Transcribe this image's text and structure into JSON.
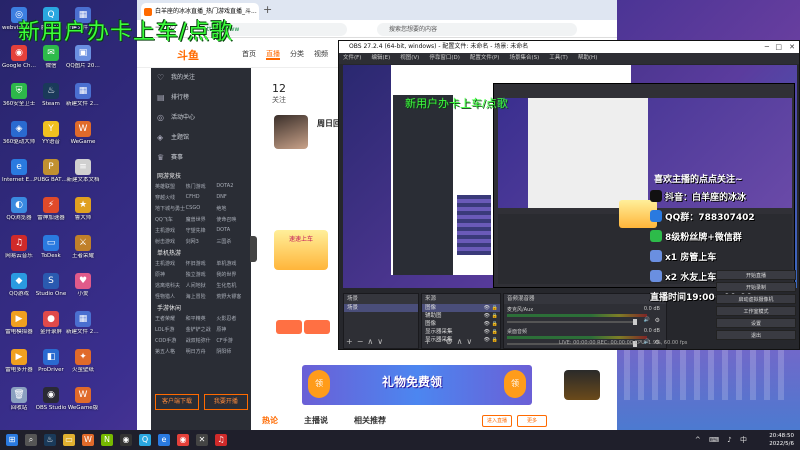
{
  "overlay_title": "新用户办卡上车/点歌",
  "desktop_icons": [
    {
      "label": "webviewget...",
      "color": "#3c7ee0",
      "glyph": "◎"
    },
    {
      "label": "腾讯QQ",
      "color": "#2aa7e0",
      "glyph": "Q"
    },
    {
      "label": "新建文件 20211...",
      "color": "#4a6fd0",
      "glyph": "▦"
    },
    {
      "label": "Google Chrome",
      "color": "#e4403a",
      "glyph": "◉"
    },
    {
      "label": "微信",
      "color": "#2dbb4a",
      "glyph": "✉"
    },
    {
      "label": "QQ图片 2021121...",
      "color": "#6a8fe0",
      "glyph": "▣"
    },
    {
      "label": "360安全卫士",
      "color": "#2db84a",
      "glyph": "⛨"
    },
    {
      "label": "Steam",
      "color": "#1a3a5a",
      "glyph": "♨"
    },
    {
      "label": "新建文件 2021121...",
      "color": "#4a6fd0",
      "glyph": "▦"
    },
    {
      "label": "360驱动大师",
      "color": "#2a6ad0",
      "glyph": "◈"
    },
    {
      "label": "YY语音",
      "color": "#f0c020",
      "glyph": "Y"
    },
    {
      "label": "WeGame",
      "color": "#e06a2a",
      "glyph": "W"
    },
    {
      "label": "Internet Explorer",
      "color": "#2a7ae0",
      "glyph": "e"
    },
    {
      "label": "PUBG BATTLEGR...",
      "color": "#c09030",
      "glyph": "P"
    },
    {
      "label": "新建文本文档",
      "color": "#d0d0d0",
      "glyph": "≡"
    },
    {
      "label": "QQ浏览器",
      "color": "#3a8ae0",
      "glyph": "◐"
    },
    {
      "label": "雷神加速器",
      "color": "#e04a2a",
      "glyph": "⚡"
    },
    {
      "label": "鲁大师",
      "color": "#e0a020",
      "glyph": "★"
    },
    {
      "label": "网易云音乐",
      "color": "#d02a2a",
      "glyph": "♫"
    },
    {
      "label": "ToDesk",
      "color": "#2a7ae0",
      "glyph": "▭"
    },
    {
      "label": "王者荣耀",
      "color": "#c0802a",
      "glyph": "⚔"
    },
    {
      "label": "QQ游戏",
      "color": "#2a9ae0",
      "glyph": "◆"
    },
    {
      "label": "Studio One",
      "color": "#2a5ab0",
      "glyph": "S"
    },
    {
      "label": "小爱",
      "color": "#e05a8a",
      "glyph": "♥"
    },
    {
      "label": "雷电模拟器",
      "color": "#f0a020",
      "glyph": "▶"
    },
    {
      "label": "金舟录屏",
      "color": "#e04a4a",
      "glyph": "●"
    },
    {
      "label": "新建文件 2022030...",
      "color": "#4a6fd0",
      "glyph": "▦"
    },
    {
      "label": "雷电多开器",
      "color": "#f0a020",
      "glyph": "▶"
    },
    {
      "label": "ProDriver",
      "color": "#2a6ad0",
      "glyph": "◧"
    },
    {
      "label": "火萤壁纸",
      "color": "#e06a2a",
      "glyph": "✦"
    },
    {
      "label": "回收站",
      "color": "#8aa0c0",
      "glyph": "🗑"
    },
    {
      "label": "OBS Studio",
      "color": "#2a2a35",
      "glyph": "◉"
    },
    {
      "label": "WeGame版",
      "color": "#e06a2a",
      "glyph": "W"
    }
  ],
  "browser": {
    "tab_title": "白羊座的冰冰直播_热门游戏直播_斗...",
    "new_tab": "+",
    "url": "https://www.douyu.com/...",
    "url_domain": "https://www",
    "search_placeholder": "搜索您想要的内容",
    "logo": "斗鱼",
    "nav": [
      "首页",
      "直播",
      "分类",
      "视频",
      "游戏"
    ],
    "sidebar_items": [
      "我的关注",
      "排行榜",
      "活动中心",
      "主题馆",
      "赛事"
    ],
    "sidebar_cat_online": "网游竞技",
    "games_online": [
      "英雄联盟",
      "热门游戏",
      "DOTA2",
      "穿越火线",
      "CFHD",
      "DNF",
      "地下城与勇士",
      "CSGO",
      "绝地",
      "QQ飞车",
      "魔兽世界",
      "使命召唤",
      "主机游戏",
      "守望先锋",
      "DOTA",
      "射击游戏",
      "剑网3",
      "三国杀"
    ],
    "sidebar_cat_single": "单机热游",
    "games_single": [
      "主机游戏",
      "怀旧游戏",
      "单机游戏",
      "原神",
      "独立游戏",
      "我的世界",
      "逃离塔科夫",
      "人间地狱",
      "生化危机",
      "怪物猎人",
      "海上冒险",
      "荒野大镖客"
    ],
    "sidebar_cat_mobile": "手游休闲",
    "games_mobile": [
      "王者荣耀",
      "和平精英",
      "火影忍者",
      "LOL手游",
      "金铲铲之战",
      "原神",
      "COD手游",
      "战双帕弥什",
      "CF手游",
      "第五人格",
      "明日方舟",
      "阴阳师"
    ],
    "btn_upload": "客户端下载",
    "btn_app": "我要开播",
    "streamer_count": "12",
    "streamer_count_label": "关注",
    "streamer_label2": "直播间",
    "pname": "周日回",
    "promo_text": "速速上车",
    "gift_text": "礼物免费领",
    "gift_badge": "领",
    "hot_tabs": [
      "热论",
      "主播说",
      "相关推荐"
    ],
    "small_btn": "进入直播",
    "small_btn2": "更多"
  },
  "obs": {
    "title": "OBS 27.2.4 (64-bit, windows) - 配置文件: 未命名 - 场景: 未命名",
    "menu": [
      "文件(F)",
      "编辑(E)",
      "视图(V)",
      "停靠窗口(D)",
      "配置文件(P)",
      "场景集合(S)",
      "工具(T)",
      "帮助(H)"
    ],
    "scenes_header": "场景",
    "scenes": [
      "场景"
    ],
    "sources_header": "来源",
    "sources": [
      "图像",
      "辅助图",
      "图像",
      "显示器采集",
      "显示器采集"
    ],
    "mixer_header": "音频混音器",
    "mixer": [
      {
        "label": "麦克风/Aux",
        "db": "0.0 dB"
      },
      {
        "label": "桌面音频",
        "db": "0.0 dB"
      }
    ],
    "preview_title": "新用户办卡上车/点歌",
    "status": "LIVE: 00:00:00   REC: 00:00:00   CPU: 1.9%, 60.00 fps",
    "controls": [
      "开始直播",
      "开始录制",
      "启动虚拟摄像机",
      "工作室模式",
      "设置",
      "退出"
    ]
  },
  "overlay": {
    "head": "喜欢主播的点点关注~",
    "lines": [
      {
        "text": "抖音：白羊座的冰冰",
        "color": "#111111"
      },
      {
        "text": "QQ群：788307402",
        "color": "#2a7ae0"
      },
      {
        "text": "8级粉丝牌+微信群",
        "color": "#2dbb4a"
      },
      {
        "text": "x1 房管上车",
        "color": "#6a8fe0"
      },
      {
        "text": "x2 水友上车",
        "color": "#6a8fe0"
      },
      {
        "text": "直播时间19:00－00:00",
        "color": ""
      }
    ]
  },
  "taskbar": {
    "apps": [
      {
        "name": "start",
        "glyph": "⊞",
        "color": "#2a7ae0"
      },
      {
        "name": "search",
        "glyph": "⌕",
        "color": "#555"
      },
      {
        "name": "steam",
        "glyph": "♨",
        "color": "#1a3a5a"
      },
      {
        "name": "file-explorer",
        "glyph": "▭",
        "color": "#e0b030"
      },
      {
        "name": "wegame",
        "glyph": "W",
        "color": "#e06a2a"
      },
      {
        "name": "nvidia",
        "glyph": "N",
        "color": "#76b900"
      },
      {
        "name": "obs",
        "glyph": "◉",
        "color": "#333"
      },
      {
        "name": "qq",
        "glyph": "Q",
        "color": "#2aa7e0"
      },
      {
        "name": "ie",
        "glyph": "e",
        "color": "#2a7ae0"
      },
      {
        "name": "chrome",
        "glyph": "◉",
        "color": "#e4403a"
      },
      {
        "name": "game",
        "glyph": "✕",
        "color": "#444"
      },
      {
        "name": "netease",
        "glyph": "♫",
        "color": "#d02a2a"
      }
    ],
    "time": "20:48:50",
    "date": "2022/5/6"
  }
}
